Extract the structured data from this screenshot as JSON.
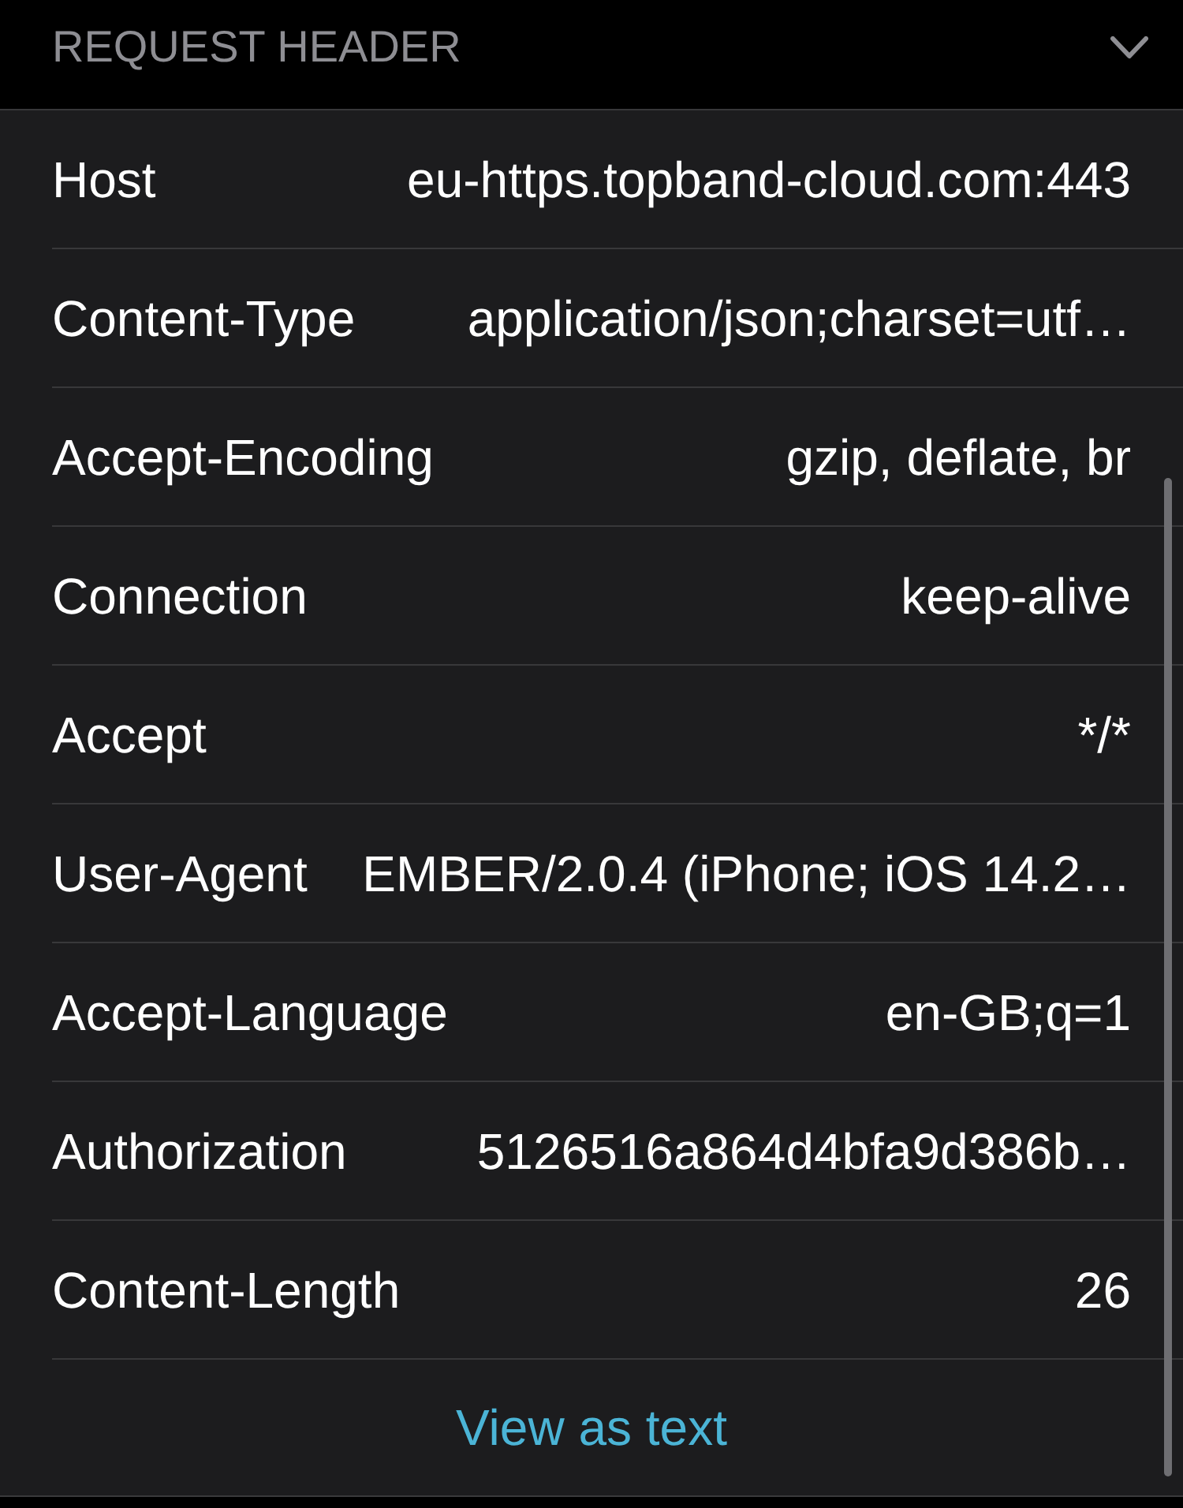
{
  "section": {
    "title": "REQUEST HEADER",
    "expanded": true
  },
  "headers": [
    {
      "name": "Host",
      "value": "eu-https.topband-cloud.com:443"
    },
    {
      "name": "Content-Type",
      "value": "application/json;charset=utf…"
    },
    {
      "name": "Accept-Encoding",
      "value": "gzip, deflate, br"
    },
    {
      "name": "Connection",
      "value": "keep-alive"
    },
    {
      "name": "Accept",
      "value": "*/*"
    },
    {
      "name": "User-Agent",
      "value": "EMBER/2.0.4 (iPhone; iOS 14.2…"
    },
    {
      "name": "Accept-Language",
      "value": "en-GB;q=1"
    },
    {
      "name": "Authorization",
      "value": "5126516a864d4bfa9d386b…"
    },
    {
      "name": "Content-Length",
      "value": "26"
    }
  ],
  "link": "View as text"
}
